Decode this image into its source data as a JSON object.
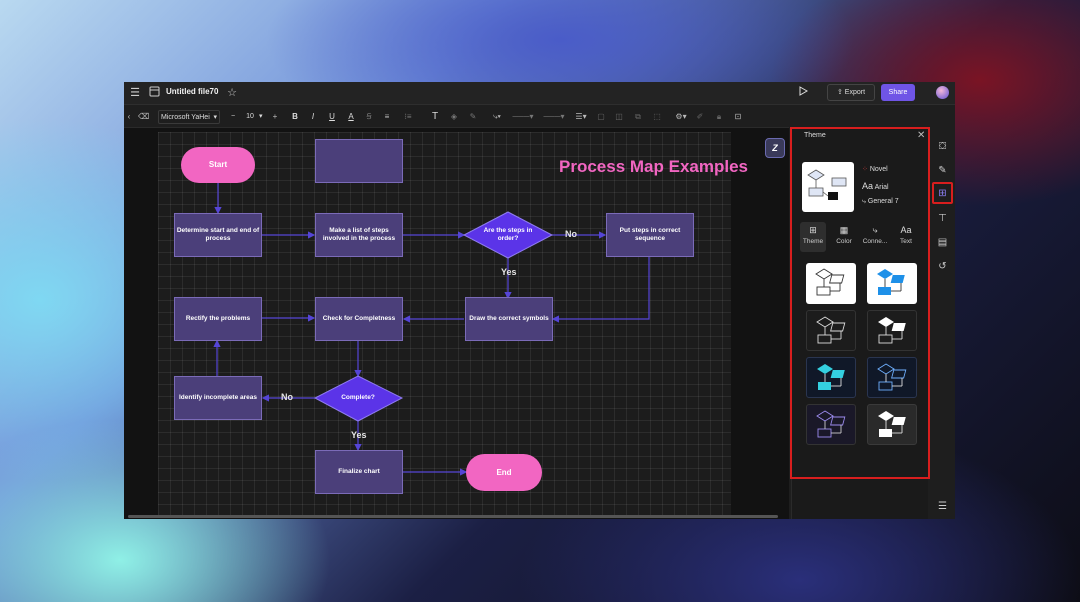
{
  "window": {
    "title": "Untitled file70",
    "export_label": "Export",
    "share_label": "Share"
  },
  "toolbar": {
    "font_family": "Microsoft YaHei",
    "font_size": "10"
  },
  "flowchart": {
    "title": "Process Map Examples",
    "nodes": {
      "start": "Start",
      "determine": "Determine start and end of process",
      "make_list": "Make a list of steps involved in the process",
      "are_steps": "Are the steps in order?",
      "put_steps": "Put steps in correct sequence",
      "rectify": "Rectify the problems",
      "check": "Check for Completness",
      "draw": "Draw the correct symbols",
      "identify": "Identify incomplete areas",
      "complete": "Complete?",
      "finalize": "Finalize chart",
      "end": "End"
    },
    "labels": {
      "no1": "No",
      "yes1": "Yes",
      "no2": "No",
      "yes2": "Yes"
    },
    "colors": {
      "node_fill": "#4b3f7a",
      "diamond_fill": "#5b34e8",
      "terminal_fill": "#f266c2",
      "connector": "#5545d6",
      "title": "#f266c2"
    }
  },
  "panel": {
    "title": "Theme",
    "theme_name": "Novel",
    "font_name": "Arial",
    "connector_name": "General 7",
    "tabs": [
      {
        "label": "Theme"
      },
      {
        "label": "Color"
      },
      {
        "label": "Conne..."
      },
      {
        "label": "Text"
      }
    ],
    "style_count": 8
  },
  "colors": {
    "accent": "#6f55e6",
    "highlight_outline": "#d81e1e"
  }
}
